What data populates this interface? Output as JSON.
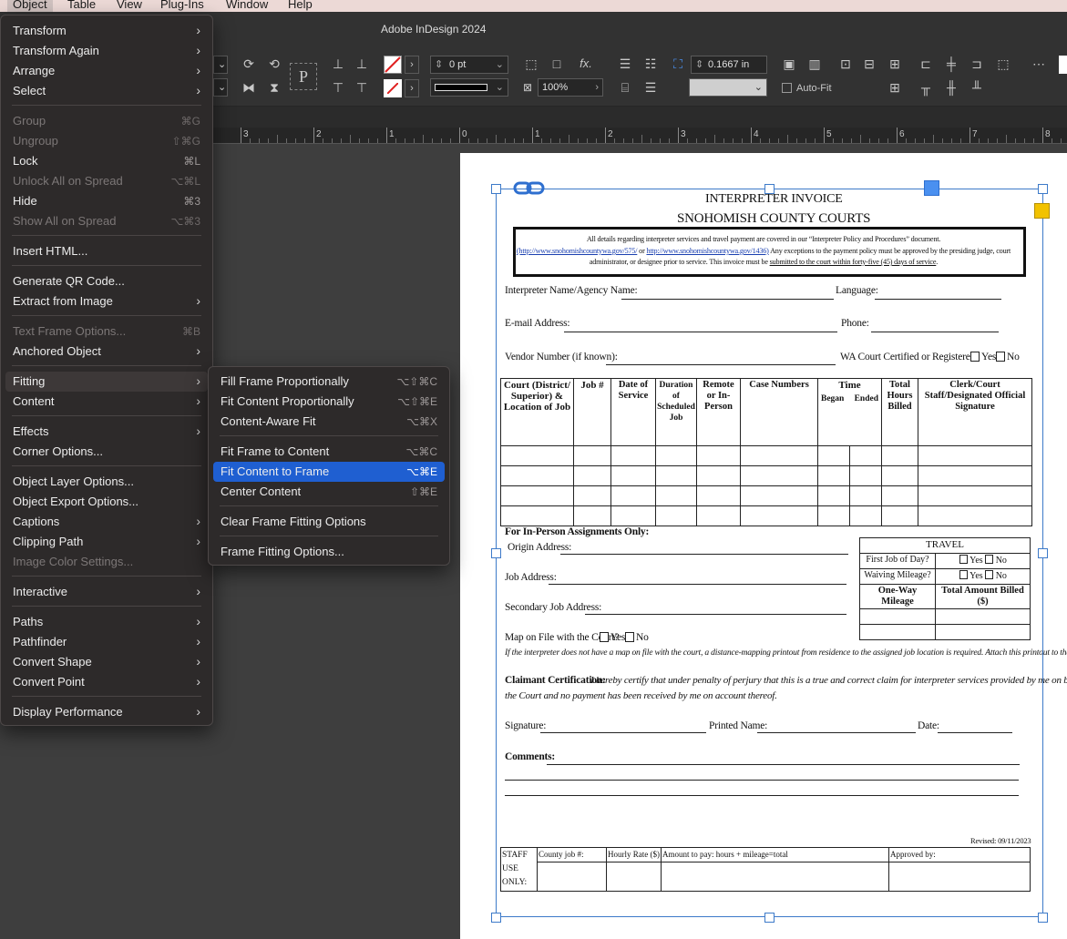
{
  "menubar": {
    "items": [
      "Object",
      "Table",
      "View",
      "Plug-Ins",
      "Window",
      "Help"
    ]
  },
  "app": {
    "title": "Adobe InDesign 2024"
  },
  "control": {
    "stroke_weight": "0 pt",
    "scale": "100%",
    "spacing": "0.1667 in",
    "autofit_label": "Auto-Fit",
    "type_tool_glyph": "P"
  },
  "ruler": {
    "labels": [
      "3",
      "2",
      "1",
      "0",
      "1",
      "2",
      "3",
      "4",
      "5",
      "6",
      "7",
      "8"
    ]
  },
  "object_menu": {
    "items": [
      {
        "label": "Transform",
        "shortcut": "",
        "submenu": true,
        "disabled": false
      },
      {
        "label": "Transform Again",
        "shortcut": "",
        "submenu": true,
        "disabled": false
      },
      {
        "label": "Arrange",
        "shortcut": "",
        "submenu": true,
        "disabled": false
      },
      {
        "label": "Select",
        "shortcut": "",
        "submenu": true,
        "disabled": false
      },
      {
        "label": "Group",
        "shortcut": "⌘G",
        "submenu": false,
        "disabled": true
      },
      {
        "label": "Ungroup",
        "shortcut": "⇧⌘G",
        "submenu": false,
        "disabled": true
      },
      {
        "label": "Lock",
        "shortcut": "⌘L",
        "submenu": false,
        "disabled": false
      },
      {
        "label": "Unlock All on Spread",
        "shortcut": "⌥⌘L",
        "submenu": false,
        "disabled": true
      },
      {
        "label": "Hide",
        "shortcut": "⌘3",
        "submenu": false,
        "disabled": false
      },
      {
        "label": "Show All on Spread",
        "shortcut": "⌥⌘3",
        "submenu": false,
        "disabled": true
      },
      {
        "label": "Insert HTML...",
        "shortcut": "",
        "submenu": false,
        "disabled": false
      },
      {
        "label": "Generate QR Code...",
        "shortcut": "",
        "submenu": false,
        "disabled": false
      },
      {
        "label": "Extract from Image",
        "shortcut": "",
        "submenu": true,
        "disabled": false
      },
      {
        "label": "Text Frame Options...",
        "shortcut": "⌘B",
        "submenu": false,
        "disabled": true
      },
      {
        "label": "Anchored Object",
        "shortcut": "",
        "submenu": true,
        "disabled": false
      },
      {
        "label": "Fitting",
        "shortcut": "",
        "submenu": true,
        "disabled": false
      },
      {
        "label": "Content",
        "shortcut": "",
        "submenu": true,
        "disabled": false
      },
      {
        "label": "Effects",
        "shortcut": "",
        "submenu": true,
        "disabled": false
      },
      {
        "label": "Corner Options...",
        "shortcut": "",
        "submenu": false,
        "disabled": false
      },
      {
        "label": "Object Layer Options...",
        "shortcut": "",
        "submenu": false,
        "disabled": false
      },
      {
        "label": "Object Export Options...",
        "shortcut": "",
        "submenu": false,
        "disabled": false
      },
      {
        "label": "Captions",
        "shortcut": "",
        "submenu": true,
        "disabled": false
      },
      {
        "label": "Clipping Path",
        "shortcut": "",
        "submenu": true,
        "disabled": false
      },
      {
        "label": "Image Color Settings...",
        "shortcut": "",
        "submenu": false,
        "disabled": true
      },
      {
        "label": "Interactive",
        "shortcut": "",
        "submenu": true,
        "disabled": false
      },
      {
        "label": "Paths",
        "shortcut": "",
        "submenu": true,
        "disabled": false
      },
      {
        "label": "Pathfinder",
        "shortcut": "",
        "submenu": true,
        "disabled": false
      },
      {
        "label": "Convert Shape",
        "shortcut": "",
        "submenu": true,
        "disabled": false
      },
      {
        "label": "Convert Point",
        "shortcut": "",
        "submenu": true,
        "disabled": false
      },
      {
        "label": "Display Performance",
        "shortcut": "",
        "submenu": true,
        "disabled": false
      }
    ]
  },
  "fitting_menu": {
    "items": [
      {
        "label": "Fill Frame Proportionally",
        "shortcut": "⌥⇧⌘C"
      },
      {
        "label": "Fit Content Proportionally",
        "shortcut": "⌥⇧⌘E"
      },
      {
        "label": "Content-Aware Fit",
        "shortcut": "⌥⌘X"
      },
      {
        "label": "Fit Frame to Content",
        "shortcut": "⌥⌘C"
      },
      {
        "label": "Fit Content to Frame",
        "shortcut": "⌥⌘E"
      },
      {
        "label": "Center Content",
        "shortcut": "⇧⌘E"
      },
      {
        "label": "Clear Frame Fitting Options",
        "shortcut": ""
      },
      {
        "label": "Frame Fitting Options...",
        "shortcut": ""
      }
    ]
  },
  "doc": {
    "title1": "INTERPRETER INVOICE",
    "title2": "SNOHOMISH COUNTY COURTS",
    "notice_line1": "All details regarding interpreter services and travel payment are covered in our “Interpreter Policy and Procedures” document.",
    "notice_link1": "(http://www.snohomishcountywa.gov/575/",
    "notice_or": " or ",
    "notice_link2": "http://www.snohomishcountywa.gov/1436)",
    "notice_line2b": " Any exceptions to the payment policy must be approved by the presiding judge, court",
    "notice_line3a": "administrator, or designee prior to service. This invoice must be ",
    "notice_line3u": "submitted to the court within forty-five (45) days of service",
    "notice_line3c": ".",
    "name_label": "Interpreter Name/Agency Name:",
    "language_label": "Language:",
    "email_label": "E-mail Address:",
    "phone_label": "Phone:",
    "vendor_label": "Vendor Number (if known):",
    "certified_label": "WA Court Certified or Registered?",
    "yes": "Yes",
    "no": "No",
    "table_headers": {
      "court": "Court (District/ Superior) & Location of Job",
      "job": "Job #",
      "date": "Date of Service",
      "duration": "Duration of Scheduled Job",
      "remote": "Remote or In-Person",
      "case": "Case Numbers",
      "time": "Time",
      "began": "Began",
      "ended": "Ended",
      "total": "Total Hours Billed",
      "clerk": "Clerk/Court Staff/Designated Official Signature"
    },
    "inperson_heading": "For In-Person Assignments Only:",
    "origin_label": "Origin Address:",
    "job_address_label": "Job Address:",
    "secondary_label": "Secondary Job Address:",
    "map_label": "Map on File with the Court?",
    "travel": {
      "title": "TRAVEL",
      "first_job": "First Job of Day?",
      "waiving": "Waiving Mileage?",
      "one_way": "One-Way Mileage",
      "total_billed": "Total Amount Billed ($)"
    },
    "map_note": "If the interpreter does not have a map on file with the court, a distance-mapping printout from residence to the assigned job location is required. Attach this printout to the invoice.",
    "claimant_label": "Claimant Certification:",
    "claimant_text1": "I hereby certify that under penalty of perjury that this is a true and correct claim for interpreter services provided by me on behalf of",
    "claimant_text2": "the Court and no payment has been received by me on account thereof.",
    "signature_label": "Signature:",
    "printed_label": "Printed Name:",
    "date_label": "Date:",
    "comments_label": "Comments:",
    "revised": "Revised: 09/11/2023",
    "staff": {
      "label": "STAFF USE ONLY:",
      "county_job": "County job #:",
      "hourly": "Hourly Rate ($)",
      "amount": "Amount to pay: hours + mileage=total",
      "approved": "Approved by:"
    }
  },
  "colors": {
    "selection": "#3d7ac9",
    "menu_highlight": "#1f5fd1",
    "menu_bg": "#2d2a2a",
    "frame_handle_fill": "#4a90f0",
    "yellow_handle": "#f2c200"
  }
}
